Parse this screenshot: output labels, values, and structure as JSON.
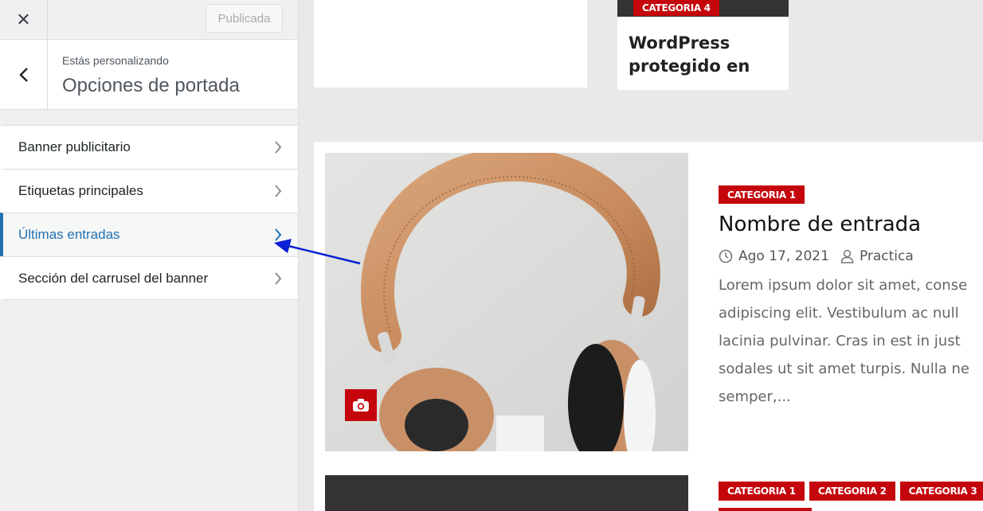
{
  "sidebar": {
    "close_glyph": "✕",
    "publish_label": "Publicada",
    "customizing_label": "Estás personalizando",
    "section_title": "Opciones de portada",
    "items": [
      {
        "label": "Banner publicitario",
        "active": false
      },
      {
        "label": "Etiquetas principales",
        "active": false
      },
      {
        "label": "Últimas entradas",
        "active": true
      },
      {
        "label": "Sección del carrusel del banner",
        "active": false
      }
    ]
  },
  "preview": {
    "top_card": {
      "category": "CATEGORIA 4",
      "title": "WordPress protegido en"
    },
    "post": {
      "category": "CATEGORIA 1",
      "title": "Nombre de entrada",
      "date": "Ago 17, 2021",
      "author": "Practica",
      "excerpt_lines": [
        "Lorem ipsum dolor sit amet, conse",
        "adipiscing elit. Vestibulum ac null",
        "lacinia pulvinar. Cras in est in just",
        "sodales ut sit amet turpis. Nulla ne",
        "semper,..."
      ]
    },
    "bottom_categories": [
      "CATEGORIA 1",
      "CATEGORIA 2",
      "CATEGORIA 3"
    ]
  },
  "colors": {
    "accent_blue": "#2271b1",
    "category_red": "#c4050c",
    "annotation_arrow": "#0a1fd6"
  },
  "icons": {
    "close": "close-icon",
    "back": "chevron-left-icon",
    "menu_chevron": "chevron-right-icon",
    "camera": "camera-icon",
    "clock": "clock-icon",
    "user": "user-icon"
  }
}
